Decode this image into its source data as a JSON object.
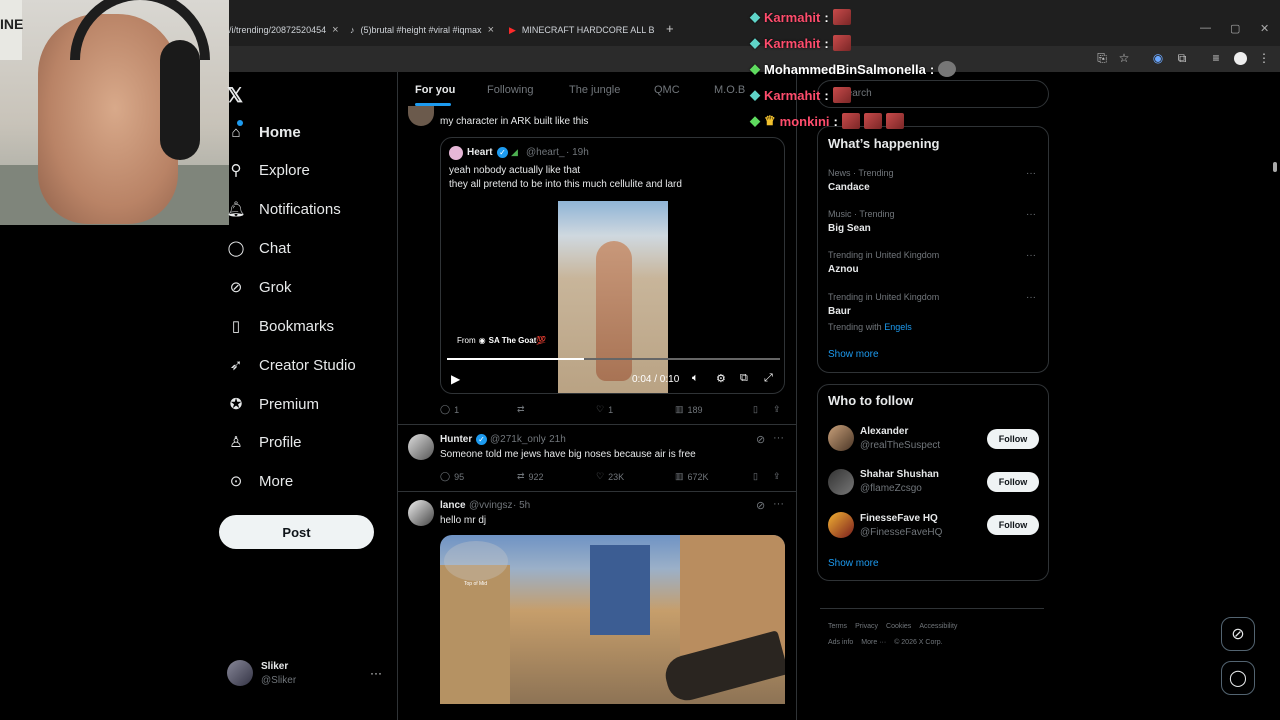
{
  "browser": {
    "tabs": [
      {
        "label": "/i/trending/20872520454",
        "icon": "x-favicon"
      },
      {
        "label": "(5)brutal #height #viral #iqmax",
        "icon": "tiktok-favicon"
      },
      {
        "label": "MINECRAFT HARDCORE ALL BO",
        "icon": "youtube-favicon"
      }
    ],
    "new_tab": "+",
    "close": "×"
  },
  "overlay_chat": [
    {
      "user": "Karmahit",
      "sep": ":",
      "color": "#ff4d6d",
      "badge": "diamond-badge"
    },
    {
      "user": "Karmahit",
      "sep": ":",
      "color": "#ff4d6d",
      "badge": "diamond-badge"
    },
    {
      "user": "MohammedBinSalmonella",
      "sep": ":",
      "color": "#ffffff",
      "badge": "gem-badge"
    },
    {
      "user": "Karmahit",
      "sep": ":",
      "color": "#ff4d6d",
      "badge": "diamond-badge"
    },
    {
      "user": "monkini",
      "sep": ":",
      "color": "#ff4d6d",
      "badge": "crown-badge"
    }
  ],
  "nav": {
    "items": [
      {
        "label": "Home",
        "icon": "home-icon"
      },
      {
        "label": "Explore",
        "icon": "search-icon"
      },
      {
        "label": "Notifications",
        "icon": "bell-icon"
      },
      {
        "label": "Chat",
        "icon": "chat-icon"
      },
      {
        "label": "Grok",
        "icon": "grok-icon"
      },
      {
        "label": "Bookmarks",
        "icon": "bookmark-icon"
      },
      {
        "label": "Creator Studio",
        "icon": "rocket-icon"
      },
      {
        "label": "Premium",
        "icon": "verified-icon"
      },
      {
        "label": "Profile",
        "icon": "person-icon"
      },
      {
        "label": "More",
        "icon": "more-circle-icon"
      }
    ],
    "post_label": "Post",
    "account": {
      "name": "Sliker",
      "handle": "@Sliker",
      "more": "···"
    }
  },
  "feed": {
    "tabs": [
      "For you",
      "Following",
      "The jungle",
      "QMC",
      "M.O.B"
    ],
    "post1": {
      "text": "my character in ARK built like this",
      "quote": {
        "name": "Heart",
        "handle": "@heart_",
        "time": "· 19h",
        "line1": "yeah nobody actually like that",
        "line2": "they all pretend to be into this much cellulite and lard",
        "from_prefix": "From",
        "from_name": "SA The Goat💯",
        "video_time": "0:04 / 0:10"
      },
      "replies": "1",
      "reposts": "",
      "likes": "1",
      "views": "189"
    },
    "post2": {
      "name": "Hunter",
      "handle": "@271k_only",
      "time": "· 21h",
      "text": "Someone told me jews have big noses because air is free",
      "replies": "95",
      "reposts": "922",
      "likes": "23K",
      "views": "672K"
    },
    "post3": {
      "name": "lance",
      "handle": "@vvingsz",
      "time": "· 5h",
      "text": "hello mr dj",
      "game_label": "Top of Mid"
    }
  },
  "sidebar": {
    "search_placeholder": "Search",
    "happening_title": "What’s happening",
    "trends": [
      {
        "cat": "News · Trending",
        "name": "Candace",
        "extra": ""
      },
      {
        "cat": "Music · Trending",
        "name": "Big Sean",
        "extra": ""
      },
      {
        "cat": "Trending in United Kingdom",
        "name": "Aznou",
        "extra": ""
      },
      {
        "cat": "Trending in United Kingdom",
        "name": "Baur",
        "extra_prefix": "Trending with",
        "extra": "Engels"
      }
    ],
    "show_more": "Show more",
    "who_title": "Who to follow",
    "who": [
      {
        "name": "Alexander",
        "handle": "@realTheSuspect"
      },
      {
        "name": "Shahar Shushan",
        "handle": "@flameZcsgo"
      },
      {
        "name": "FinesseFave HQ",
        "handle": "@FinesseFaveHQ"
      }
    ],
    "follow_label": "Follow",
    "footer_row1": [
      "Terms",
      "Privacy",
      "Cookies",
      "Accessibility"
    ],
    "footer_row2": [
      "Ads info",
      "More ···",
      "© 2026 X Corp."
    ]
  },
  "colors": {
    "accent": "#1d9bf0",
    "bg": "#000000",
    "border": "#2f3336"
  }
}
